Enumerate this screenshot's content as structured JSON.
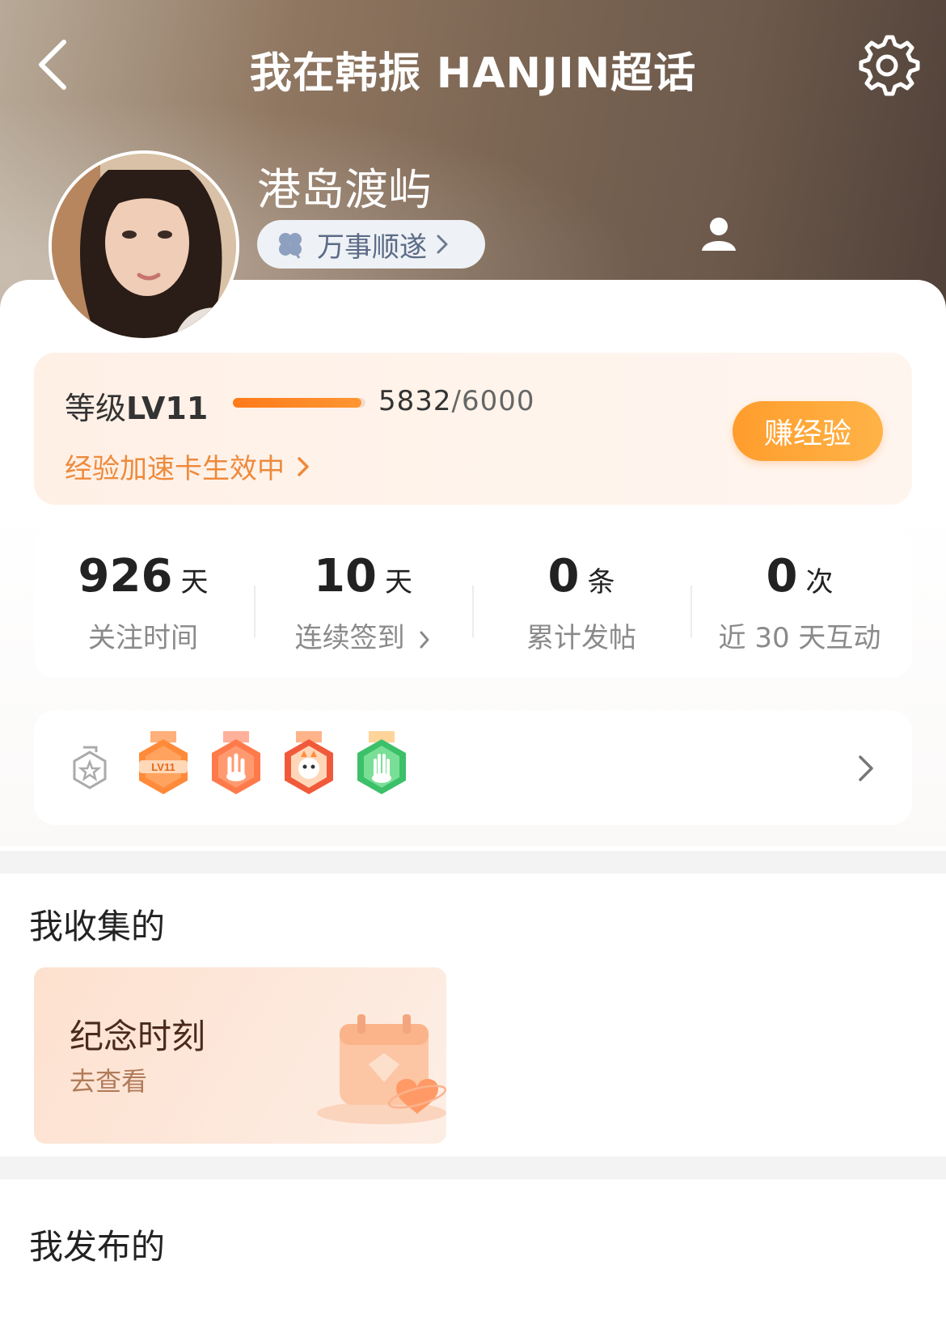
{
  "header": {
    "title": "我在韩振 HANJIN超话",
    "username": "港岛渡屿",
    "tag_label": "万事顺遂"
  },
  "level": {
    "prefix": "等级",
    "level": "LV11",
    "progress": 0.972,
    "exp_current": "5832",
    "exp_max": "/6000",
    "boost_text": "经验加速卡生效中",
    "earn_button": "赚经验"
  },
  "stats": [
    {
      "value": "926",
      "unit": "天",
      "label": "关注时间"
    },
    {
      "value": "10",
      "unit": "天",
      "label": "连续签到"
    },
    {
      "value": "0",
      "unit": "条",
      "label": "累计发帖"
    },
    {
      "value": "0",
      "unit": "次",
      "label": "近 30 天互动"
    }
  ],
  "badges": {
    "items": [
      {
        "name": "lv11-badge-icon",
        "text": "LV11",
        "color": "#ff8a3a"
      },
      {
        "name": "gesture-badge-icon",
        "text": "",
        "color": "#ff7a4a"
      },
      {
        "name": "dragon-badge-icon",
        "text": "",
        "color": "#f05a3a"
      },
      {
        "name": "hand-badge-icon",
        "text": "",
        "color": "#3cc06a"
      }
    ]
  },
  "sections": {
    "collected": "我收集的",
    "published": "我发布的"
  },
  "memory_card": {
    "title": "纪念时刻",
    "subtitle": "去查看"
  },
  "colors": {
    "accent": "#ff8a1f",
    "boost": "#ee8a3c"
  }
}
